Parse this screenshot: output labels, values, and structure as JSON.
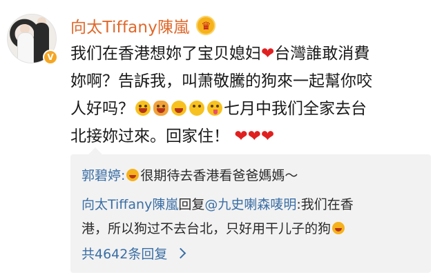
{
  "post": {
    "username": "向太Tiffany陳嵐",
    "badge_icon": "crown-badge-icon",
    "verified_icon": "verified-v-icon",
    "line1_a": "我们在香港想妳了宝贝媳妇",
    "line1_b": "台灣誰敢消費",
    "line2": "妳啊？告訴我，叫萧敬騰的狗來一起幫你咬",
    "line3_a": "人好吗？",
    "line3_b": "七月中我们全家去台",
    "line4": "北接妳过來。回家住！"
  },
  "comments": {
    "c1_author": "郭碧婷:",
    "c1_text": "很期待去香港看爸爸媽媽～",
    "c2_author": "向太Tiffany陳嵐",
    "c2_reply_word": "回复",
    "c2_mention": "@九史喇森唛明",
    "c2_text_a": ":我们在香",
    "c2_text_b": "港，所以狗过不去台北，只好用干儿子的狗",
    "more_replies": "共4642条回复"
  },
  "colors": {
    "username": "#e0682a",
    "link": "#3a6ea5",
    "heart": "#e02020"
  }
}
